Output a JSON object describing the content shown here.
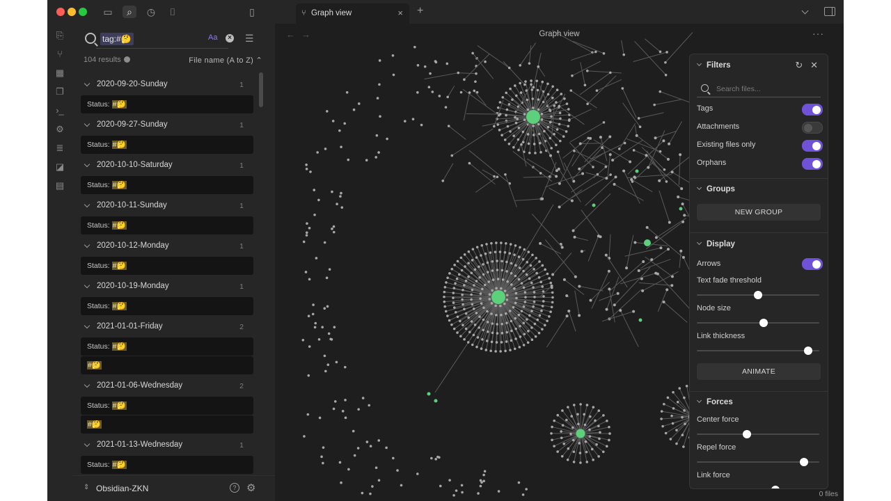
{
  "window": {
    "traffic_colors": [
      "#ff5f57",
      "#febc2e",
      "#28c840"
    ]
  },
  "search": {
    "query": "tag:#🤔",
    "match_case_label": "Aa",
    "results_count": "104 results",
    "sort_label": "File name (A to Z)",
    "groups": [
      {
        "title": "2020-09-20-Sunday",
        "count": "1",
        "matches": [
          {
            "prefix": "Status: ",
            "tag": "#🤔"
          }
        ]
      },
      {
        "title": "2020-09-27-Sunday",
        "count": "1",
        "matches": [
          {
            "prefix": "Status: ",
            "tag": "#🤔"
          }
        ]
      },
      {
        "title": "2020-10-10-Saturday",
        "count": "1",
        "matches": [
          {
            "prefix": "Status: ",
            "tag": "#🤔"
          }
        ]
      },
      {
        "title": "2020-10-11-Sunday",
        "count": "1",
        "matches": [
          {
            "prefix": "Status: ",
            "tag": "#🤔"
          }
        ]
      },
      {
        "title": "2020-10-12-Monday",
        "count": "1",
        "matches": [
          {
            "prefix": "Status: ",
            "tag": "#🤔"
          }
        ]
      },
      {
        "title": "2020-10-19-Monday",
        "count": "1",
        "matches": [
          {
            "prefix": "Status: ",
            "tag": "#🤔"
          }
        ]
      },
      {
        "title": "2021-01-01-Friday",
        "count": "2",
        "matches": [
          {
            "prefix": "Status: ",
            "tag": "#🤔"
          },
          {
            "prefix": "",
            "tag": "#🤔"
          }
        ]
      },
      {
        "title": "2021-01-06-Wednesday",
        "count": "2",
        "matches": [
          {
            "prefix": "Status: ",
            "tag": "#🤔"
          },
          {
            "prefix": "",
            "tag": "#🤔"
          }
        ]
      },
      {
        "title": "2021-01-13-Wednesday",
        "count": "1",
        "matches": [
          {
            "prefix": "Status: ",
            "tag": "#🤔"
          }
        ]
      }
    ]
  },
  "vault": {
    "name": "Obsidian-ZKN"
  },
  "tab": {
    "label": "Graph view"
  },
  "graph": {
    "title": "Graph view",
    "files_count": "0 files"
  },
  "filters": {
    "title": "Filters",
    "search_placeholder": "Search files...",
    "toggles": [
      {
        "label": "Tags",
        "on": true
      },
      {
        "label": "Attachments",
        "on": false
      },
      {
        "label": "Existing files only",
        "on": true
      },
      {
        "label": "Orphans",
        "on": true
      }
    ],
    "groups_title": "Groups",
    "new_group_label": "NEW GROUP",
    "display_title": "Display",
    "arrows_label": "Arrows",
    "arrows_on": true,
    "text_fade_label": "Text fade threshold",
    "text_fade_value": 0.5,
    "node_size_label": "Node size",
    "node_size_value": 0.55,
    "link_thickness_label": "Link thickness",
    "link_thickness_value": 0.94,
    "animate_label": "ANIMATE",
    "forces_title": "Forces",
    "center_force_label": "Center force",
    "center_force_value": 0.4,
    "repel_force_label": "Repel force",
    "repel_force_value": 0.9,
    "link_force_label": "Link force",
    "link_force_value": 0.65
  }
}
